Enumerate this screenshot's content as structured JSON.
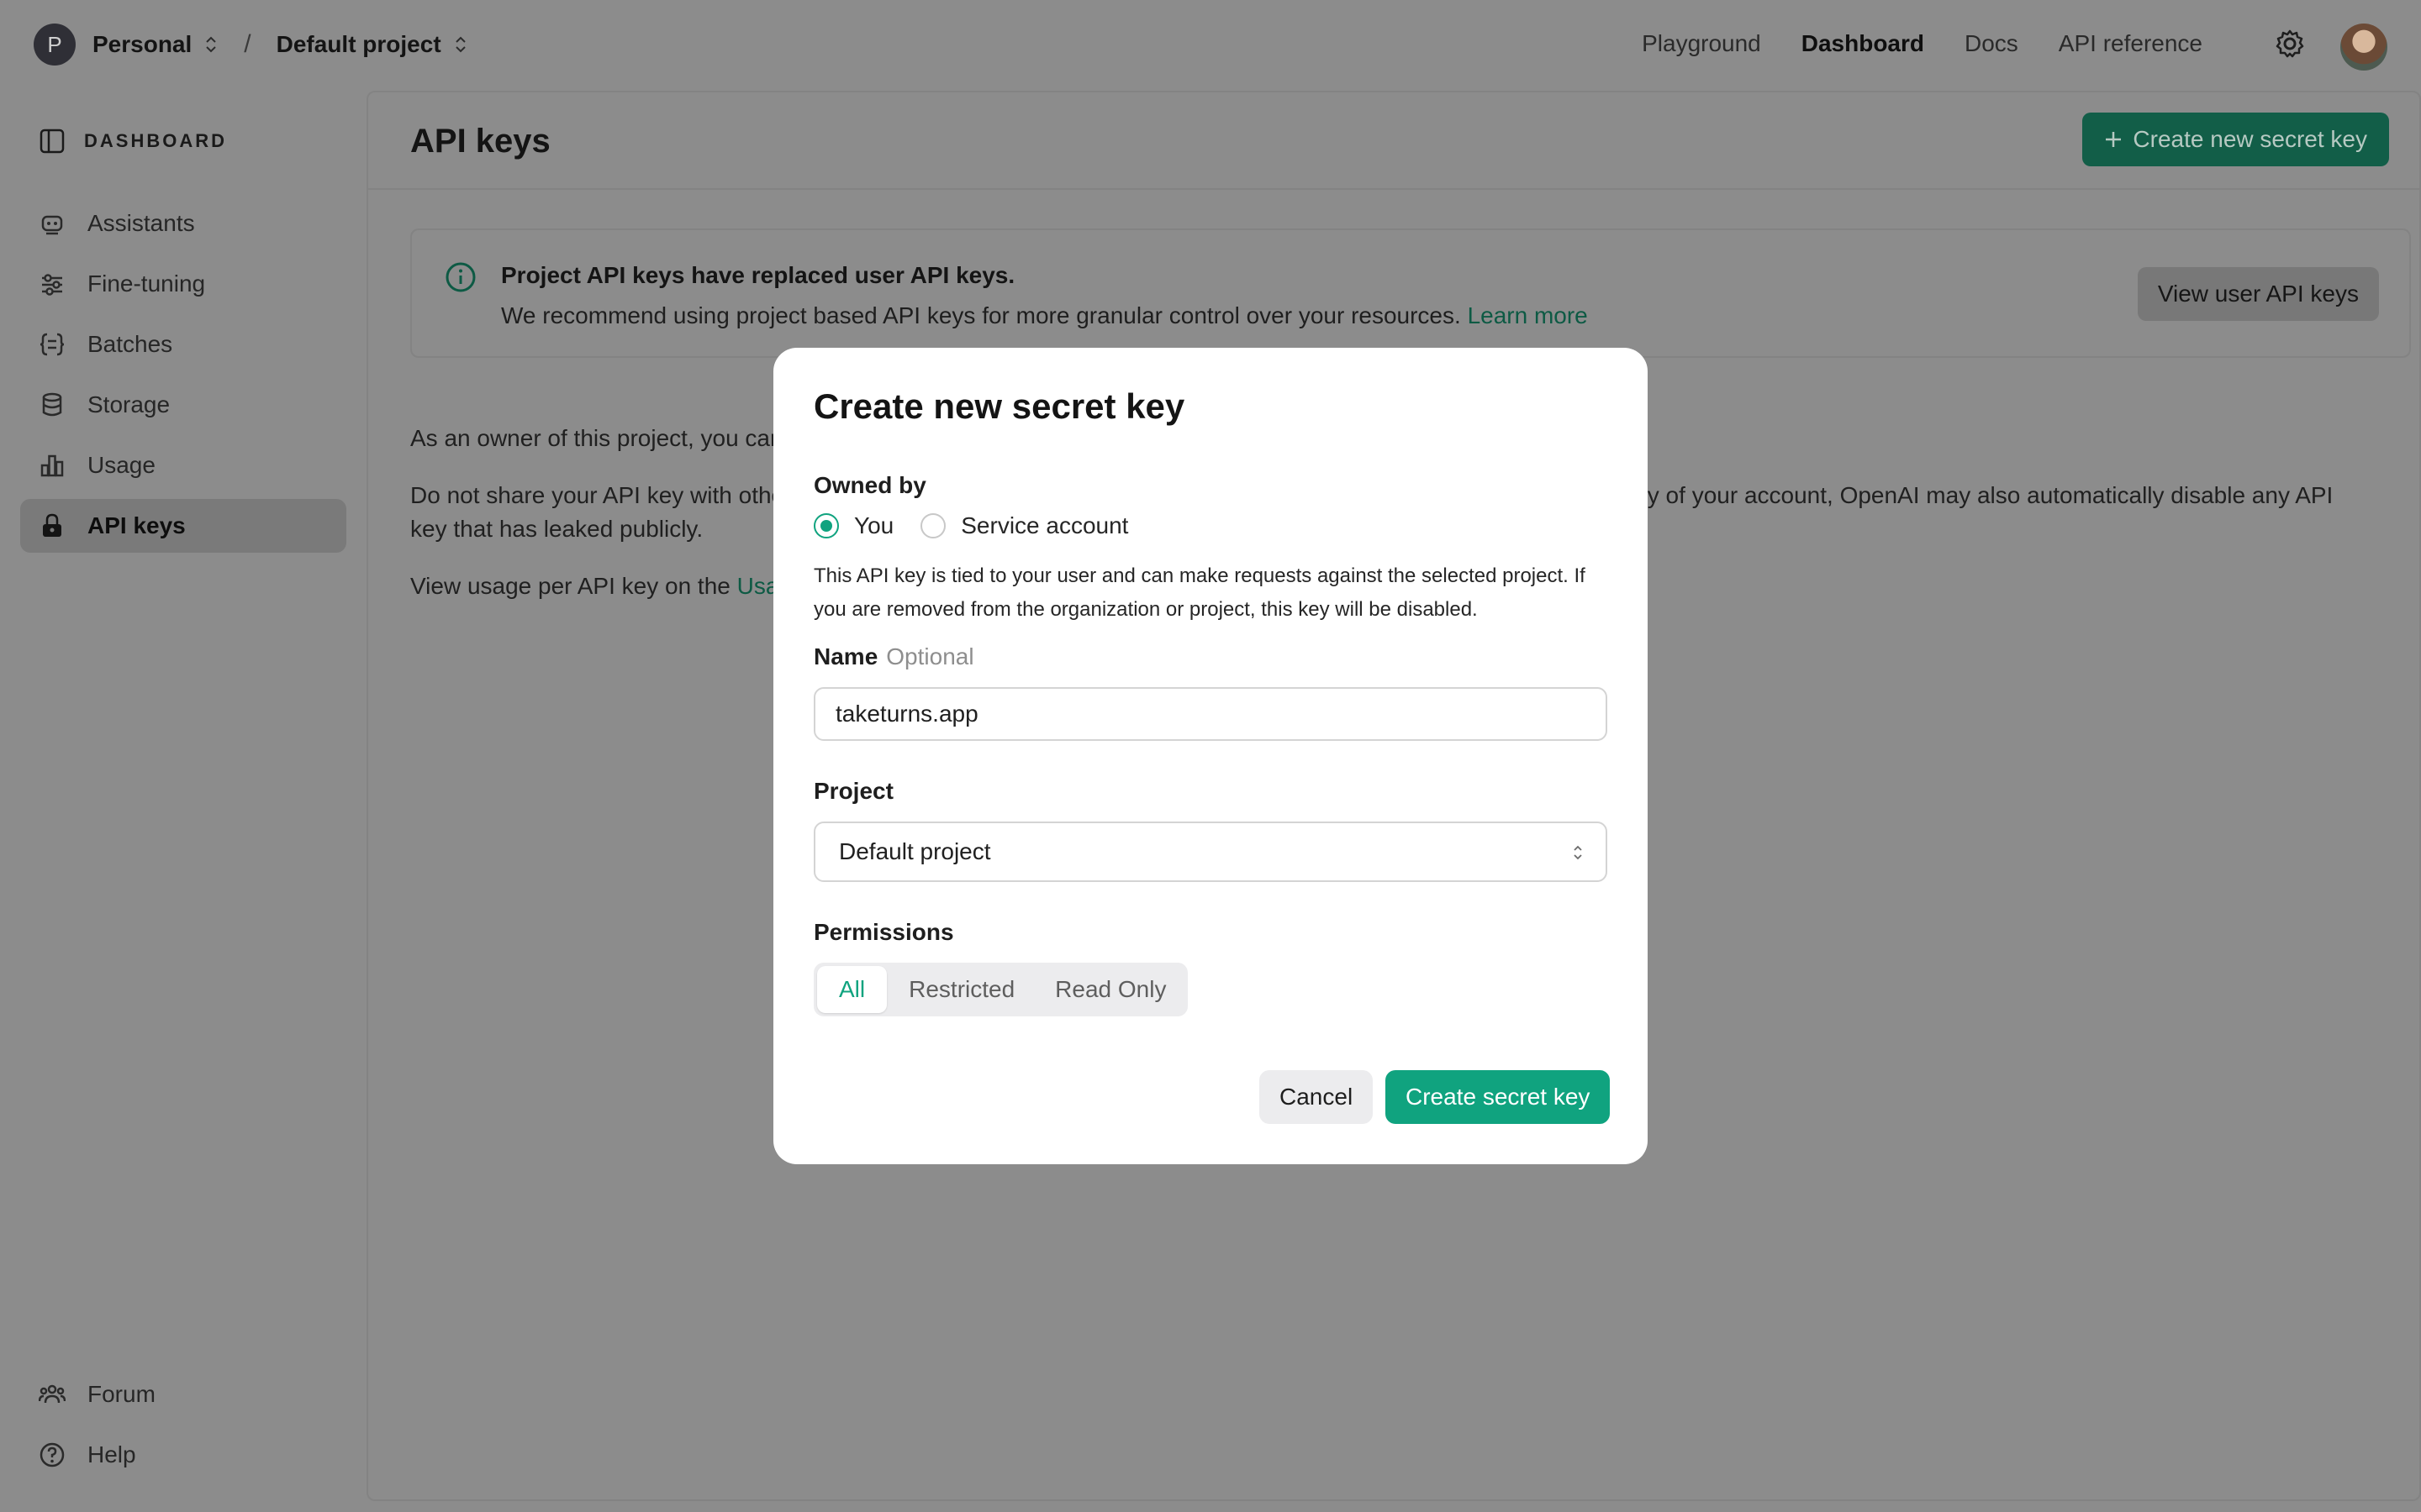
{
  "topbar": {
    "org_initial": "P",
    "org_name": "Personal",
    "separator": "/",
    "project_name": "Default project",
    "nav": [
      {
        "label": "Playground"
      },
      {
        "label": "Dashboard",
        "active": true
      },
      {
        "label": "Docs"
      },
      {
        "label": "API reference"
      }
    ]
  },
  "sidebar": {
    "header": "DASHBOARD",
    "items": [
      {
        "label": "Assistants",
        "icon": "robot-icon"
      },
      {
        "label": "Fine-tuning",
        "icon": "sliders-icon"
      },
      {
        "label": "Batches",
        "icon": "braces-icon"
      },
      {
        "label": "Storage",
        "icon": "database-icon"
      },
      {
        "label": "Usage",
        "icon": "bar-chart-icon"
      },
      {
        "label": "API keys",
        "icon": "lock-icon",
        "active": true
      }
    ],
    "footer": [
      {
        "label": "Forum",
        "icon": "people-icon"
      },
      {
        "label": "Help",
        "icon": "help-icon"
      }
    ]
  },
  "main": {
    "title": "API keys",
    "create_button": "Create new secret key",
    "notice": {
      "heading": "Project API keys have replaced user API keys.",
      "body": "We recommend using project based API keys for more granular control over your resources.",
      "link": "Learn more",
      "button": "View user API keys"
    },
    "para1": "As an owner of this project, you can",
    "para2a": "Do not share your API key with othe",
    "para2b": "ty of your account, OpenAI may also automatically disable any API",
    "para2c": "key that has leaked publicly.",
    "para3_prefix": "View usage per API key on the",
    "para3_link": "Usag"
  },
  "modal": {
    "title": "Create new secret key",
    "owned_by_label": "Owned by",
    "owner_options": [
      "You",
      "Service account"
    ],
    "owner_selected": "You",
    "help_text": "This API key is tied to your user and can make requests against the selected project. If you are removed from the organization or project, this key will be disabled.",
    "name_label": "Name",
    "name_optional": "Optional",
    "name_value": "taketurns.app",
    "project_label": "Project",
    "project_value": "Default project",
    "permissions_label": "Permissions",
    "permissions": [
      "All",
      "Restricted",
      "Read Only"
    ],
    "permissions_selected": "All",
    "cancel": "Cancel",
    "submit": "Create secret key"
  },
  "colors": {
    "accent": "#10a37f",
    "overlay_bg": "#8c8c8c",
    "modal_bg": "#ffffff"
  }
}
